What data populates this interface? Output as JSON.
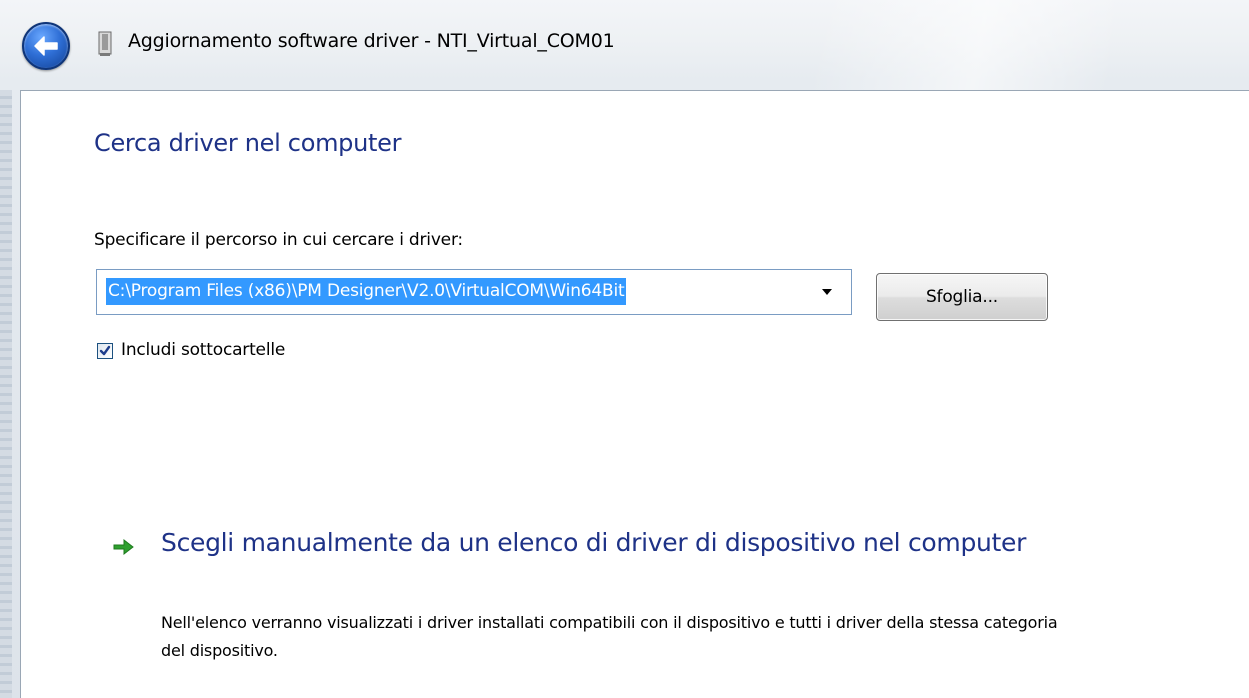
{
  "window": {
    "title": "Aggiornamento software driver - NTI_Virtual_COM01",
    "back_icon": "back-arrow-icon",
    "device_icon": "device-icon"
  },
  "page": {
    "heading": "Cerca driver nel computer",
    "path_label": "Specificare il percorso in cui cercare i driver:",
    "path_value": "C:\\Program Files (x86)\\PM Designer\\V2.0\\VirtualCOM\\Win64Bit",
    "browse_label": "Sfoglia...",
    "include_subfolders": {
      "label": "Includi sottocartelle",
      "checked": true
    },
    "manual_option": {
      "title": "Scegli manualmente da un elenco di driver di dispositivo nel computer",
      "description": "Nell'elenco verranno visualizzati i driver installati compatibili con il dispositivo e tutti i driver della stessa categoria del dispositivo.",
      "icon": "green-arrow-icon"
    }
  },
  "colors": {
    "heading": "#1e3287",
    "selection": "#3399ff",
    "link_arrow": "#2fa02f"
  }
}
